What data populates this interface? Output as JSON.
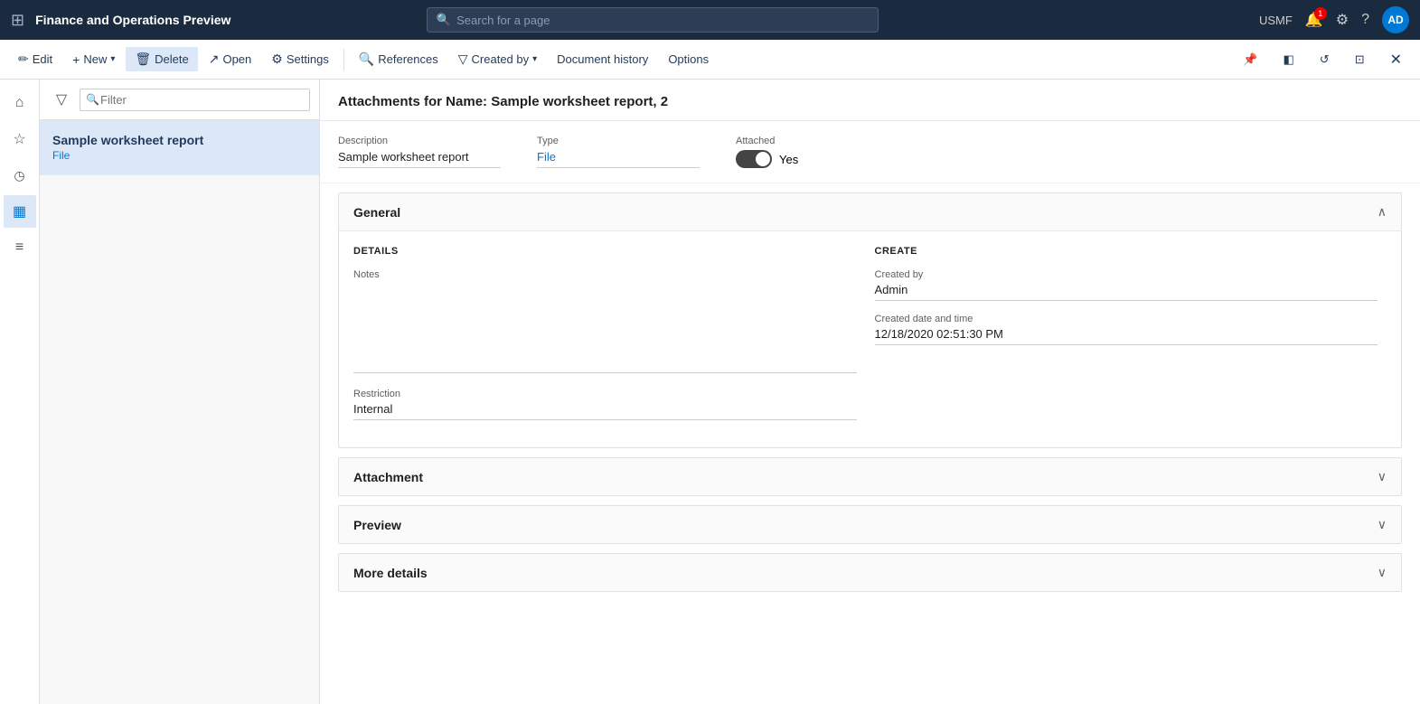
{
  "topnav": {
    "grid_icon": "⊞",
    "app_title": "Finance and Operations Preview",
    "search_placeholder": "Search for a page",
    "org": "USMF",
    "notif_count": "1",
    "avatar_initials": "AD"
  },
  "toolbar": {
    "edit_label": "Edit",
    "new_label": "New",
    "delete_label": "Delete",
    "open_label": "Open",
    "settings_label": "Settings",
    "references_label": "References",
    "created_by_label": "Created by",
    "document_history_label": "Document history",
    "options_label": "Options"
  },
  "sidebar_icons": [
    {
      "name": "home-icon",
      "icon": "⌂"
    },
    {
      "name": "favorites-icon",
      "icon": "★"
    },
    {
      "name": "recent-icon",
      "icon": "🕐"
    },
    {
      "name": "workspaces-icon",
      "icon": "▦"
    },
    {
      "name": "list-icon",
      "icon": "≡"
    }
  ],
  "list_panel": {
    "filter_placeholder": "Filter",
    "items": [
      {
        "title": "Sample worksheet report",
        "sub": "File",
        "selected": true
      }
    ]
  },
  "detail": {
    "header_title": "Attachments for Name: Sample worksheet report, 2",
    "description_label": "Description",
    "description_value": "Sample worksheet report",
    "type_label": "Type",
    "type_value": "File",
    "attached_label": "Attached",
    "attached_value": "Yes",
    "toggle_on": true,
    "sections": {
      "general": {
        "title": "General",
        "expanded": true,
        "details_heading": "DETAILS",
        "create_heading": "CREATE",
        "notes_label": "Notes",
        "notes_value": "",
        "restriction_label": "Restriction",
        "restriction_value": "Internal",
        "created_by_label": "Created by",
        "created_by_value": "Admin",
        "created_date_label": "Created date and time",
        "created_date_value": "12/18/2020 02:51:30 PM"
      },
      "attachment": {
        "title": "Attachment",
        "expanded": false
      },
      "preview": {
        "title": "Preview",
        "expanded": false
      },
      "more_details": {
        "title": "More details",
        "expanded": false
      }
    }
  }
}
